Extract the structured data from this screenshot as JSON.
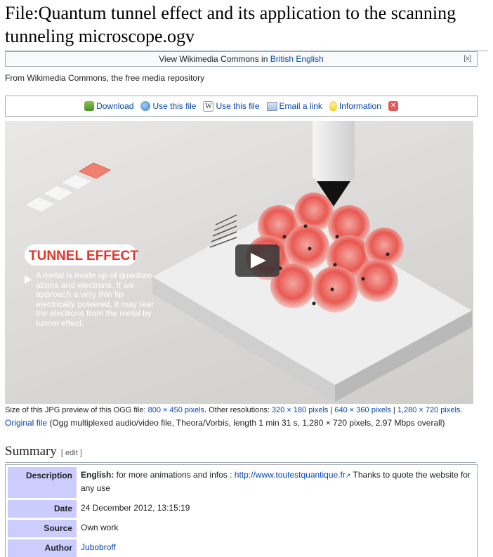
{
  "page": {
    "title": "File:Quantum tunnel effect and its application to the scanning tunneling microscope.ogv"
  },
  "langbar": {
    "prefix": "View Wikimedia Commons in ",
    "link": "British English",
    "close": "[x]"
  },
  "from_text": "From Wikimedia Commons, the free media repository",
  "toolbar": {
    "download": "Download",
    "use_web": "Use this file",
    "use_wiki": "Use this file",
    "email": "Email a link",
    "information": "Information"
  },
  "video": {
    "heading": "TUNNEL EFFECT",
    "caption": "A metal is made up of quantum atoms and electrons. If we approach a very thin tip electrically powered, it may tear the electrons from the metal by tunnel effect."
  },
  "meta": {
    "preview_prefix": "Size of this JPG preview of this OGG file: ",
    "preview_size": "800 × 450 pixels",
    "other_prefix": ". Other resolutions: ",
    "res1": "320 × 180 pixels",
    "res2": "640 × 360 pixels",
    "res3": "1,280 × 720 pixels",
    "original_link": "Original file",
    "original_desc": " (Ogg multiplexed audio/video file, Theora/Vorbis, length 1 min 31 s, 1,280 × 720 pixels, 2.97 Mbps overall)"
  },
  "summary": {
    "heading": "Summary",
    "edit": "[ edit ]",
    "rows": {
      "description_label": "Description",
      "description_lang": "English:",
      "description_text": " for more animations and infos : ",
      "description_link": "http://www.toutestquantique.fr",
      "description_tail": " Thanks to quote the website for any use",
      "date_label": "Date",
      "date_value": "24 December 2012, 13:15:19",
      "source_label": "Source",
      "source_value": "Own work",
      "author_label": "Author",
      "author_value": "Jubobroff"
    }
  },
  "colors": {
    "link": "#0645ad",
    "label_bg": "#ccccff",
    "tunnel_red": "#e8322a"
  }
}
